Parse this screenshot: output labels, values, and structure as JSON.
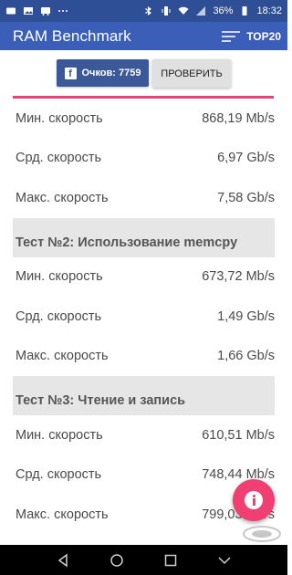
{
  "status_bar": {
    "battery": "36%",
    "time": "18:32",
    "left_icons": [
      "mail-icon",
      "image-icon",
      "bus-icon",
      "dots-icon"
    ],
    "right_icons": [
      "bluetooth-icon",
      "vibrate-icon",
      "wifi-icon",
      "no-sim-icon",
      "battery-icon"
    ]
  },
  "app_bar": {
    "title": "RAM Benchmark",
    "top_label": "TOP20"
  },
  "actions": {
    "fb_label": "Очков: 7759",
    "check_label": "ПРОВЕРИТЬ"
  },
  "colors": {
    "status_bar": "#2e4e96",
    "app_bar": "#3b5fb8",
    "accent_line": "#e9437a",
    "fab": "#ef3f73",
    "facebook": "#3b5998"
  },
  "results": {
    "test1": {
      "rows": [
        {
          "label": "Мин. скорость",
          "value": "868,19 Mb/s"
        },
        {
          "label": "Срд. скорость",
          "value": "6,97 Gb/s"
        },
        {
          "label": "Макс. скорость",
          "value": "7,58 Gb/s"
        }
      ]
    },
    "test2": {
      "title": "Тест №2: Использование memcpy",
      "rows": [
        {
          "label": "Мин. скорость",
          "value": "673,72 Mb/s"
        },
        {
          "label": "Срд. скорость",
          "value": "1,49 Gb/s"
        },
        {
          "label": "Макс. скорость",
          "value": "1,66 Gb/s"
        }
      ]
    },
    "test3": {
      "title": "Тест №3: Чтение и запись",
      "rows": [
        {
          "label": "Мин. скорость",
          "value": "610,51 Mb/s"
        },
        {
          "label": "Срд. скорость",
          "value": "748,44 Mb/s"
        },
        {
          "label": "Макс. скорость",
          "value": "799,03 Mb/s"
        }
      ]
    }
  },
  "fab_icon": "info-icon",
  "nav": [
    "back-icon",
    "home-icon",
    "recents-icon",
    "menu-icon"
  ]
}
